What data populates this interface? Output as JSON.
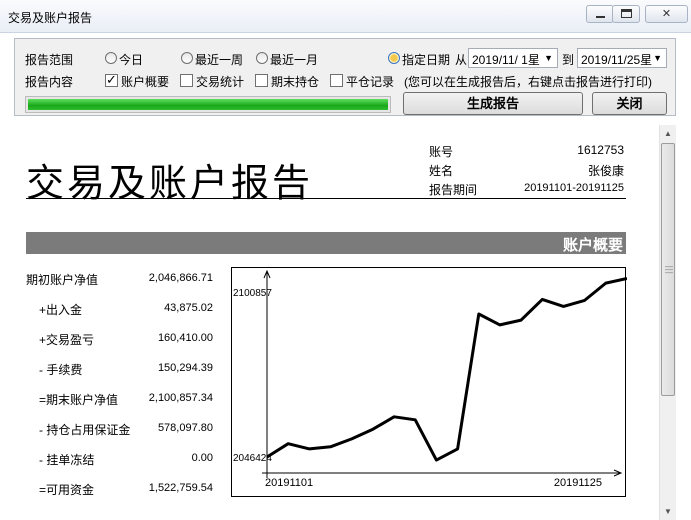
{
  "window": {
    "title": "交易及账户报告"
  },
  "controls": {
    "range_label": "报告范围",
    "content_label": "报告内容",
    "radios": {
      "today": "今日",
      "week": "最近一周",
      "month": "最近一月",
      "specified": "指定日期"
    },
    "selected_range": "specified",
    "from_label": "从",
    "to_label": "到",
    "from_date": "2019/11/ 1星",
    "to_date": "2019/11/25星",
    "checkboxes": [
      {
        "label": "账户概要",
        "checked": true
      },
      {
        "label": "交易统计",
        "checked": false
      },
      {
        "label": "期末持仓",
        "checked": false
      },
      {
        "label": "平仓记录",
        "checked": false
      }
    ],
    "hint": "(您可以在生成报告后，右键点击报告进行打印)",
    "progress_fraction": 1.0,
    "generate_label": "生成报告",
    "close_label": "关闭"
  },
  "report": {
    "title": "交易及账户报告",
    "account_label": "账号",
    "account_value": "1612753",
    "name_label": "姓名",
    "name_value": "张俊康",
    "period_label": "报告期间",
    "period_value": "20191101-20191125",
    "section_title": "账户概要",
    "rows": [
      {
        "label": "期初账户净值",
        "value": "2,046,866.71"
      },
      {
        "label": "+出入金",
        "value": "43,875.02"
      },
      {
        "label": "+交易盈亏",
        "value": "160,410.00"
      },
      {
        "label": "- 手续费",
        "value": "150,294.39"
      },
      {
        "label": "=期末账户净值",
        "value": "2,100,857.34"
      },
      {
        "label": "- 持仓占用保证金",
        "value": "578,097.80"
      },
      {
        "label": "- 挂单冻结",
        "value": "0.00"
      },
      {
        "label": "=可用资金",
        "value": "1,522,759.54"
      }
    ]
  },
  "chart_data": {
    "type": "line",
    "y_tick_labels": [
      "2100857",
      "2046424"
    ],
    "x_tick_labels": [
      "20191101",
      "20191125"
    ],
    "ylim": [
      2046424,
      2100857
    ],
    "values": [
      2046424,
      2050800,
      2049100,
      2049800,
      2052400,
      2055600,
      2059700,
      2058700,
      2045400,
      2049100,
      2093600,
      2090000,
      2091600,
      2098400,
      2096100,
      2098100,
      2103800,
      2105300
    ],
    "grid": false,
    "legend": "none"
  },
  "colors": {
    "progress": "#2ebd2e",
    "section_band": "#7b7b7b"
  }
}
